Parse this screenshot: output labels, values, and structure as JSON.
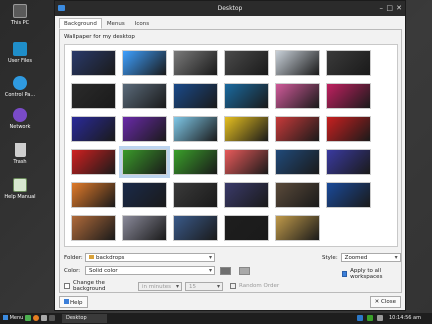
{
  "desktop_icons": [
    {
      "label": "This PC",
      "icon": "computer-icon",
      "color": "#5a5a5a"
    },
    {
      "label": "User Files",
      "icon": "home-folder-icon",
      "color": "#1f8ec9"
    },
    {
      "label": "Control Pa...",
      "icon": "control-panel-icon",
      "color": "#2f9ae0"
    },
    {
      "label": "Network",
      "icon": "network-icon",
      "color": "#7a4bc8"
    },
    {
      "label": "Trash",
      "icon": "trash-icon",
      "color": "#cfcfcf"
    },
    {
      "label": "Help Manual",
      "icon": "help-book-icon",
      "color": "#d8e8d0"
    }
  ],
  "dialog": {
    "title": "Desktop",
    "tabs": [
      "Background",
      "Menus",
      "Icons"
    ],
    "active_tab": "Background",
    "wallpaper_label": "Wallpaper for my desktop",
    "folder_label": "Folder:",
    "folder_value": "backdrops",
    "style_label": "Style:",
    "style_value": "Zoomed",
    "color_label": "Color:",
    "color_value": "Solid color",
    "apply_all_label": "Apply to all workspaces",
    "apply_all_checked": true,
    "change_bg_label": "Change the background",
    "change_bg_checked": false,
    "interval_unit": "in minutes",
    "interval_value": "15",
    "random_order_label": "Random Order",
    "help_label": "Help",
    "close_label": "Close",
    "swatch_colors": [
      "#6f6f6f",
      "#a9a9a9"
    ]
  },
  "thumbnails": [
    [
      "#2a3a6a",
      "#3ea0ff",
      "#7a7a7a",
      "#4a4a4a",
      "#c8d0d8",
      "#3a3a3a"
    ],
    [
      "#2b2b2b",
      "#5a6a7a",
      "#1a4a8a",
      "#1a6aa0",
      "#d05a9a",
      "#c02060"
    ],
    [
      "#2a2a9a",
      "#6a2aaa",
      "#7fc8e8",
      "#e6c020",
      "#c83a3a",
      "#c82020"
    ],
    [
      "#d02020",
      "#3a9a2a",
      "#3aa02a",
      "#e85a5a",
      "#204a7a",
      "#3a3aa0"
    ],
    [
      "#e07a2a",
      "#1a2a4a",
      "#3a3a3a",
      "#3a3a6a",
      "#5a4a3a",
      "#1a4a9a"
    ],
    [
      "#b06a3a",
      "#8a8a9a",
      "#3a5a8a",
      "#1e1e1e",
      "#c09a4a"
    ]
  ],
  "selected_thumbnail": [
    3,
    1
  ],
  "taskbar": {
    "menu_label": "Menu",
    "window_label": "Desktop",
    "clock": "10:14:56 am"
  }
}
